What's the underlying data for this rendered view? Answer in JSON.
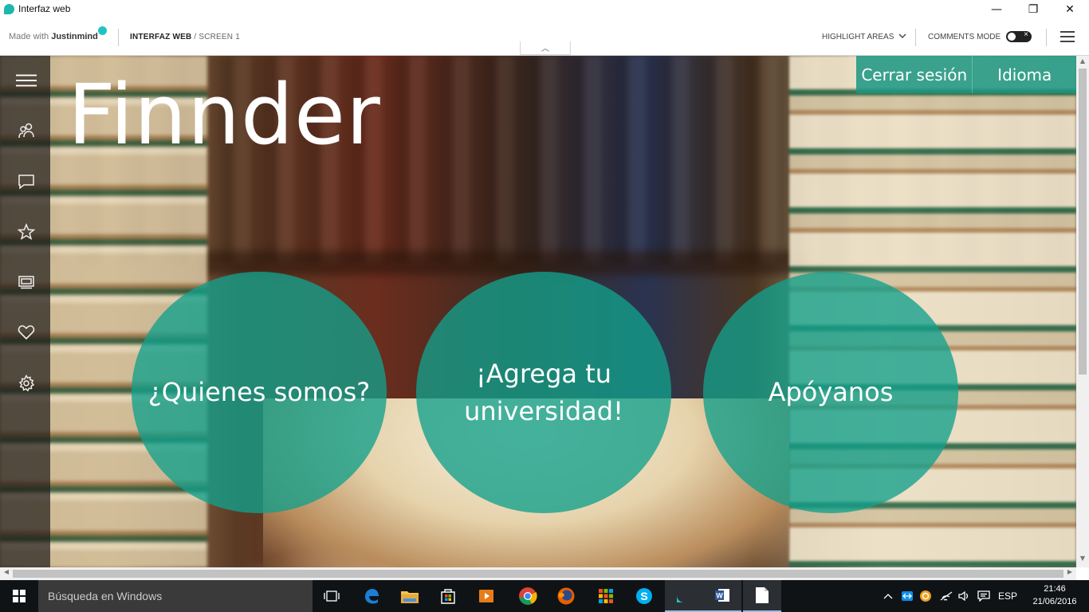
{
  "window": {
    "title": "Interfaz web",
    "minimize_glyph": "—",
    "restore_glyph": "❐",
    "close_glyph": "✕"
  },
  "toolbar": {
    "made_with_prefix": "Made with",
    "made_with_brand": "Justinmind",
    "crumb_project": "INTERFAZ WEB",
    "crumb_screen": "/ SCREEN 1",
    "highlight_areas": "HIGHLIGHT AREAS",
    "comments_mode": "COMMENTS MODE",
    "collapse_glyph": "︿"
  },
  "page": {
    "brand": "Finnder",
    "nav": {
      "logout": "Cerrar sesión",
      "language": "Idioma"
    },
    "circles": {
      "about": "¿Quienes somos?",
      "add_university_line1": "¡Agrega tu",
      "add_university_line2": "universidad!",
      "support": "Apóyanos"
    },
    "sidebar_icons": [
      "menu-icon",
      "users-icon",
      "chat-icon",
      "star-icon",
      "slides-icon",
      "heart-icon",
      "gear-icon"
    ]
  },
  "taskbar": {
    "search_placeholder": "Búsqueda en Windows",
    "language": "ESP",
    "time": "21:46",
    "date": "21/06/2016",
    "apps": [
      "task-view-icon",
      "edge-icon",
      "file-explorer-icon",
      "store-icon",
      "media-player-icon",
      "chrome-icon",
      "firefox-icon",
      "office-apps-icon",
      "skype-icon",
      "justinmind-icon",
      "word-icon",
      "document-icon"
    ]
  }
}
